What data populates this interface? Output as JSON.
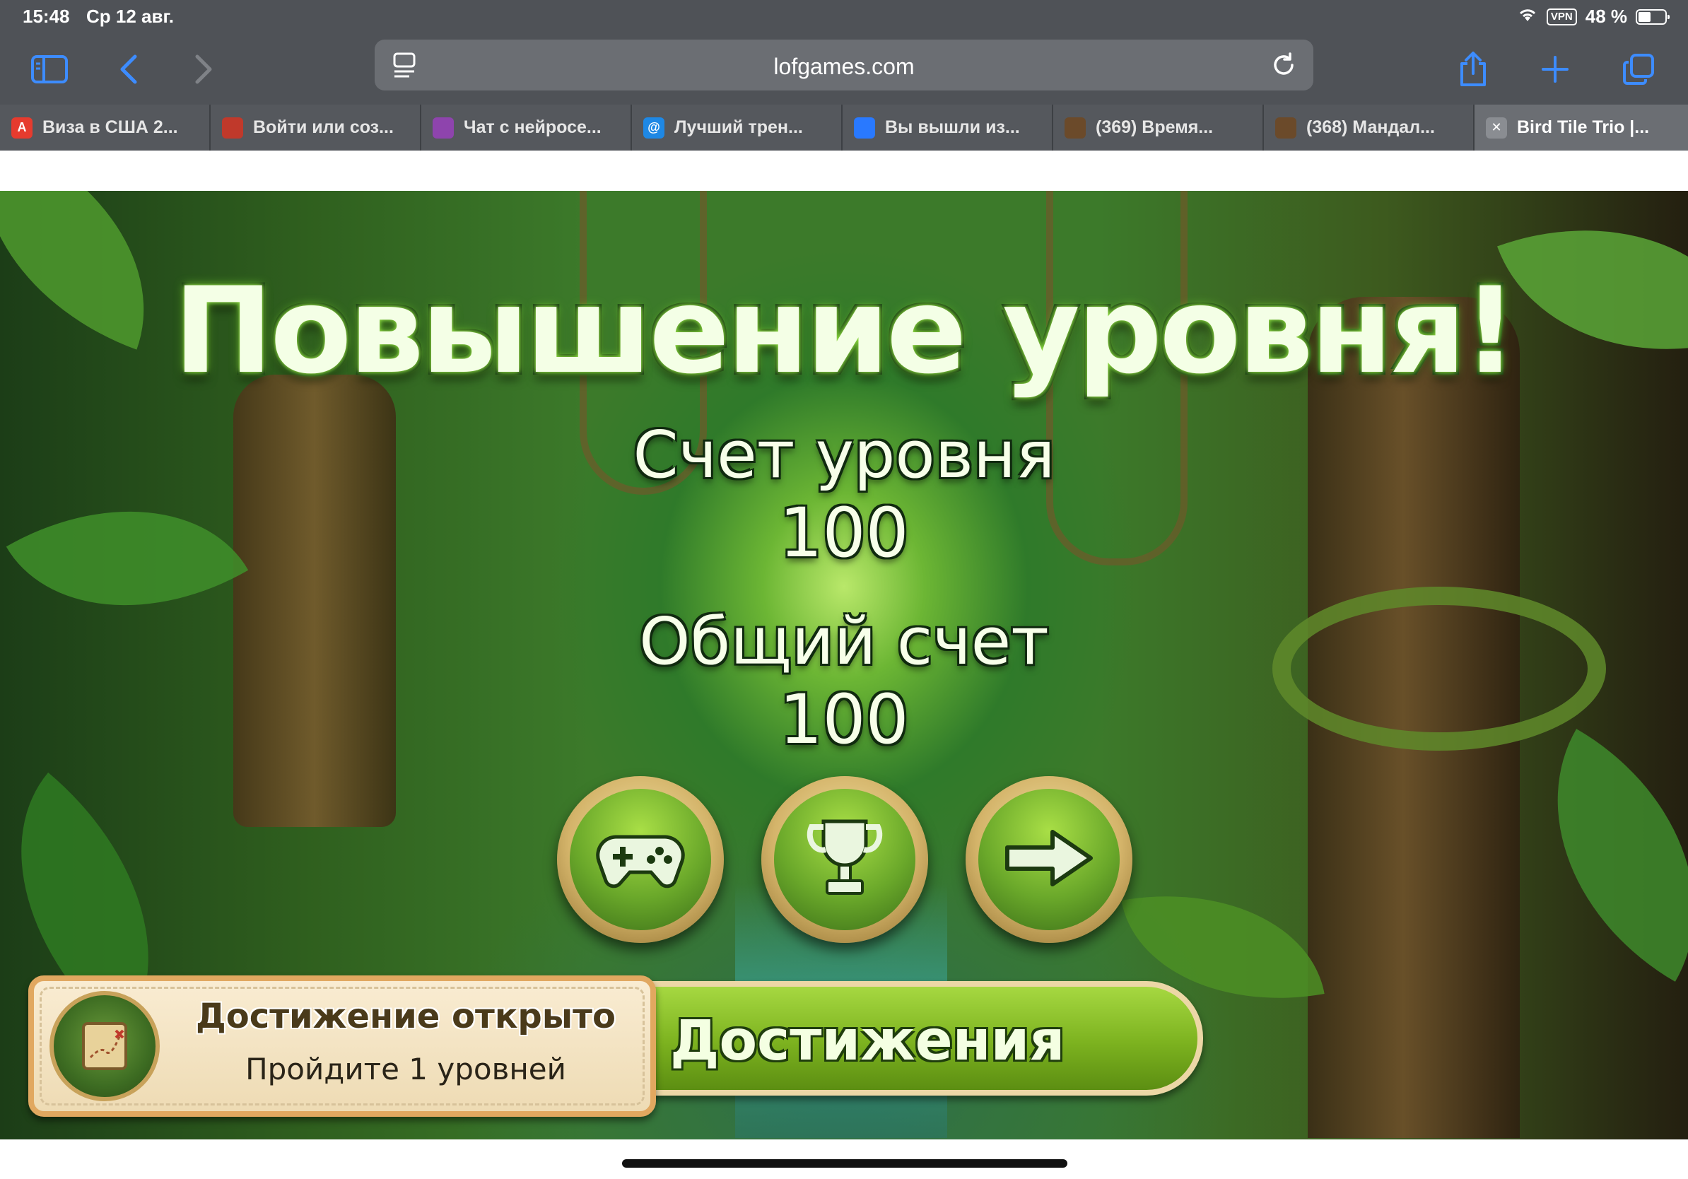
{
  "status_bar": {
    "time": "15:48",
    "date": "Ср 12 авг.",
    "vpn": "VPN",
    "battery": "48 %",
    "battery_level": 0.48
  },
  "toolbar": {
    "url": "lofgames.com",
    "icons": [
      "sidebar-icon",
      "back-icon",
      "forward-icon",
      "reader-icon",
      "reload-icon",
      "share-icon",
      "plus-icon",
      "tabs-icon"
    ]
  },
  "tabs": [
    {
      "label": "Виза в США 2...",
      "favicon": "A",
      "color": "#e63b2e"
    },
    {
      "label": "Войти или соз...",
      "favicon": "",
      "color": "#c0392b"
    },
    {
      "label": "Чат с нейросе...",
      "favicon": "",
      "color": "#8e44ad"
    },
    {
      "label": "Лучший трен...",
      "favicon": "@",
      "color": "#1e88e5"
    },
    {
      "label": "Вы вышли из...",
      "favicon": "",
      "color": "#2979ff"
    },
    {
      "label": "(369) Время...",
      "favicon": "",
      "color": "#6b4a2a"
    },
    {
      "label": "(368) Мандал...",
      "favicon": "",
      "color": "#6b4a2a"
    },
    {
      "label": "Bird Tile Trio |...",
      "favicon": "✕",
      "color": "#8a8d92"
    }
  ],
  "game": {
    "title": "Повышение уровня!",
    "level_score_label": "Счет уровня",
    "level_score_value": "100",
    "total_score_label": "Общий счет",
    "total_score_value": "100",
    "achievement": {
      "title": "Достижение открыто",
      "description": "Пройдите 1 уровней"
    },
    "achievements_button": "Достижения"
  }
}
